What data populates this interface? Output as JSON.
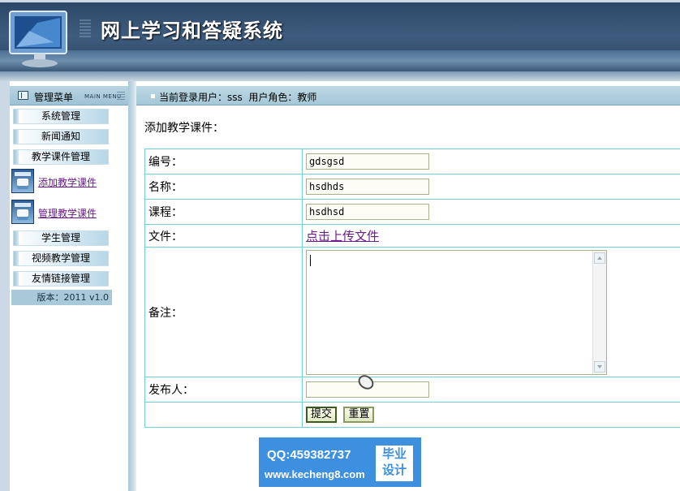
{
  "header": {
    "title": "网上学习和答疑系统"
  },
  "sidebar": {
    "title": "管理菜单",
    "subtitle": "MAIN MENU",
    "items": [
      {
        "label": "系统管理"
      },
      {
        "label": "新闻通知"
      },
      {
        "label": "教学课件管理"
      }
    ],
    "sub_items": [
      {
        "label": "添加教学课件",
        "icon": "courseware-add-icon"
      },
      {
        "label": "管理教学课件",
        "icon": "courseware-manage-icon"
      }
    ],
    "items_after": [
      {
        "label": "学生管理"
      },
      {
        "label": "视频教学管理"
      },
      {
        "label": "友情链接管理"
      }
    ],
    "version": "版本：2011  v1.0"
  },
  "info_bar": {
    "text": "当前登录用户：sss  用户角色：教师"
  },
  "main": {
    "page_title": "添加教学课件：",
    "form": {
      "code_label": "编号：",
      "code_value": "gdsgsd",
      "name_label": "名称：",
      "name_value": "hsdhds",
      "course_label": "课程：",
      "course_value": "hsdhsd",
      "file_label": "文件：",
      "file_link": "点击上传文件",
      "note_label": "备注：",
      "note_value": "",
      "publisher_label": "发布人：",
      "publisher_value": "",
      "submit_label": "提交",
      "reset_label": "重置"
    }
  },
  "watermark": {
    "qq": "QQ:459382737",
    "url": "www.kecheng8.com",
    "badge_line1": "毕业",
    "badge_line2": "设计"
  }
}
